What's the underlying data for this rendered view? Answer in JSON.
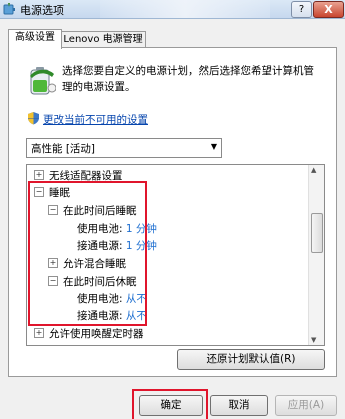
{
  "window": {
    "title": "电源选项"
  },
  "tabs": [
    {
      "label": "高级设置"
    },
    {
      "label": "Lenovo 电源管理"
    }
  ],
  "description": "选择您要自定义的电源计划，然后选择您希望计算机管理的电源设置。",
  "change_link": "更改当前不可用的设置",
  "plan_select": {
    "value": "高性能 [活动]"
  },
  "tree": {
    "rows": [
      {
        "expander": "+",
        "label": "无线适配器设置"
      },
      {
        "expander": "−",
        "label": "睡眠"
      },
      {
        "expander": "−",
        "label": "在此时间后睡眠"
      },
      {
        "label": "使用电池:",
        "value": "1 分钟"
      },
      {
        "label": "接通电源:",
        "value": "1 分钟"
      },
      {
        "expander": "+",
        "label": "允许混合睡眠"
      },
      {
        "expander": "−",
        "label": "在此时间后休眠"
      },
      {
        "label": "使用电池:",
        "value": "从不"
      },
      {
        "label": "接通电源:",
        "value": "从不"
      },
      {
        "expander": "+",
        "label": "允许使用唤醒定时器"
      }
    ]
  },
  "buttons": {
    "restore": "还原计划默认值(R)",
    "ok": "确定",
    "cancel": "取消",
    "apply": "应用(A)"
  },
  "titlebar_buttons": {
    "help": "?",
    "close": "X"
  },
  "colors": {
    "highlight": "#e0152c",
    "link": "#0645ad",
    "value": "#1e6fd0"
  }
}
